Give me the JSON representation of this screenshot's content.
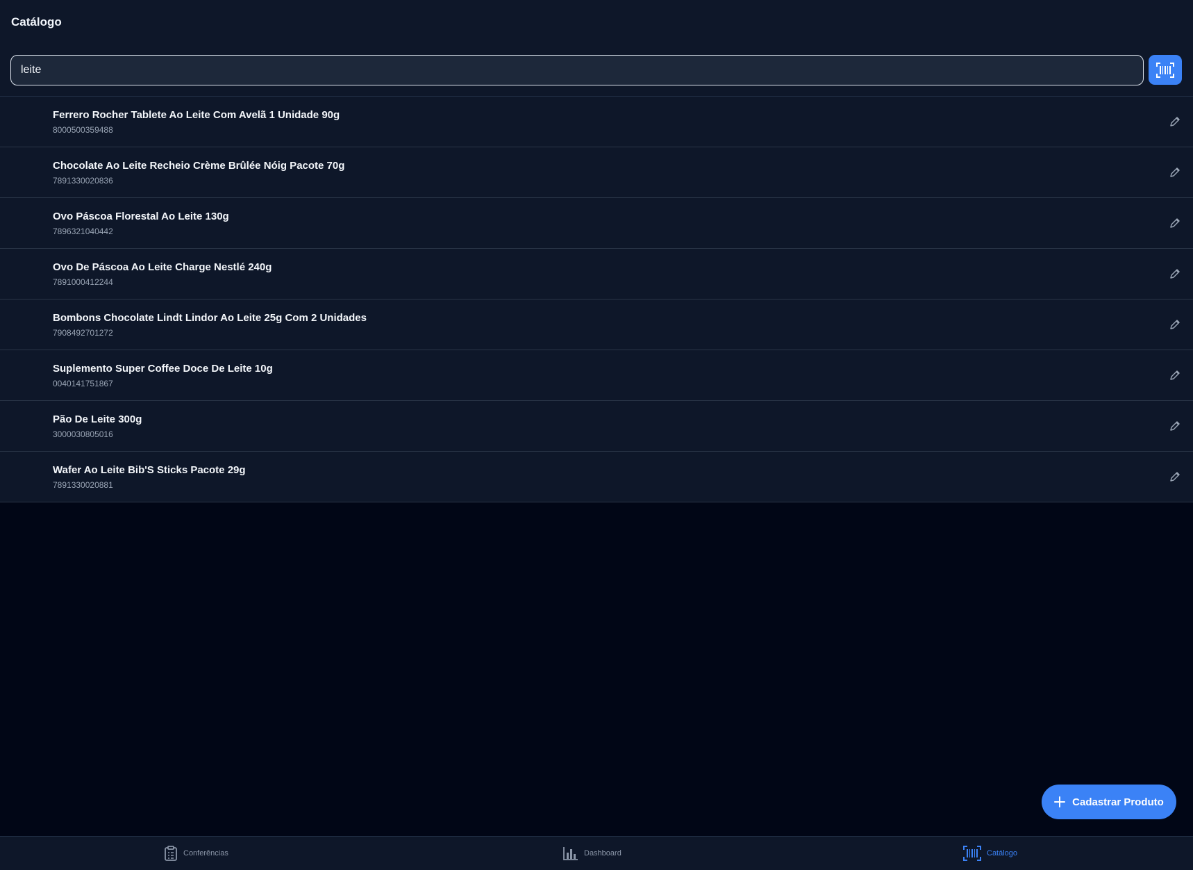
{
  "header": {
    "title": "Catálogo",
    "search": {
      "value": "leite",
      "placeholder": ""
    }
  },
  "products": [
    {
      "name": "Ferrero Rocher Tablete Ao Leite Com Avelã 1 Unidade 90g",
      "code": "8000500359488"
    },
    {
      "name": "Chocolate Ao Leite Recheio Crème Brûlée Nóig Pacote 70g",
      "code": "7891330020836"
    },
    {
      "name": "Ovo Páscoa Florestal Ao Leite 130g",
      "code": "7896321040442"
    },
    {
      "name": "Ovo De Páscoa Ao Leite Charge Nestlé 240g",
      "code": "7891000412244"
    },
    {
      "name": "Bombons Chocolate Lindt Lindor Ao Leite 25g Com 2 Unidades",
      "code": "7908492701272"
    },
    {
      "name": "Suplemento Super Coffee Doce De Leite 10g",
      "code": "0040141751867"
    },
    {
      "name": "Pão De Leite 300g",
      "code": "3000030805016"
    },
    {
      "name": "Wafer Ao Leite Bib'S Sticks Pacote 29g",
      "code": "7891330020881"
    }
  ],
  "fab": {
    "label": "Cadastrar Produto",
    "icon": "plus-icon"
  },
  "nav": {
    "items": [
      {
        "label": "Conferências",
        "icon": "clipboard-icon",
        "active": false
      },
      {
        "label": "Dashboard",
        "icon": "bar-chart-icon",
        "active": false
      },
      {
        "label": "Catálogo",
        "icon": "barcode-icon",
        "active": true
      }
    ]
  },
  "colors": {
    "background": "#010616",
    "surface": "#0e1729",
    "accent": "#3b82f6",
    "muted_text": "#9aa5b5"
  }
}
